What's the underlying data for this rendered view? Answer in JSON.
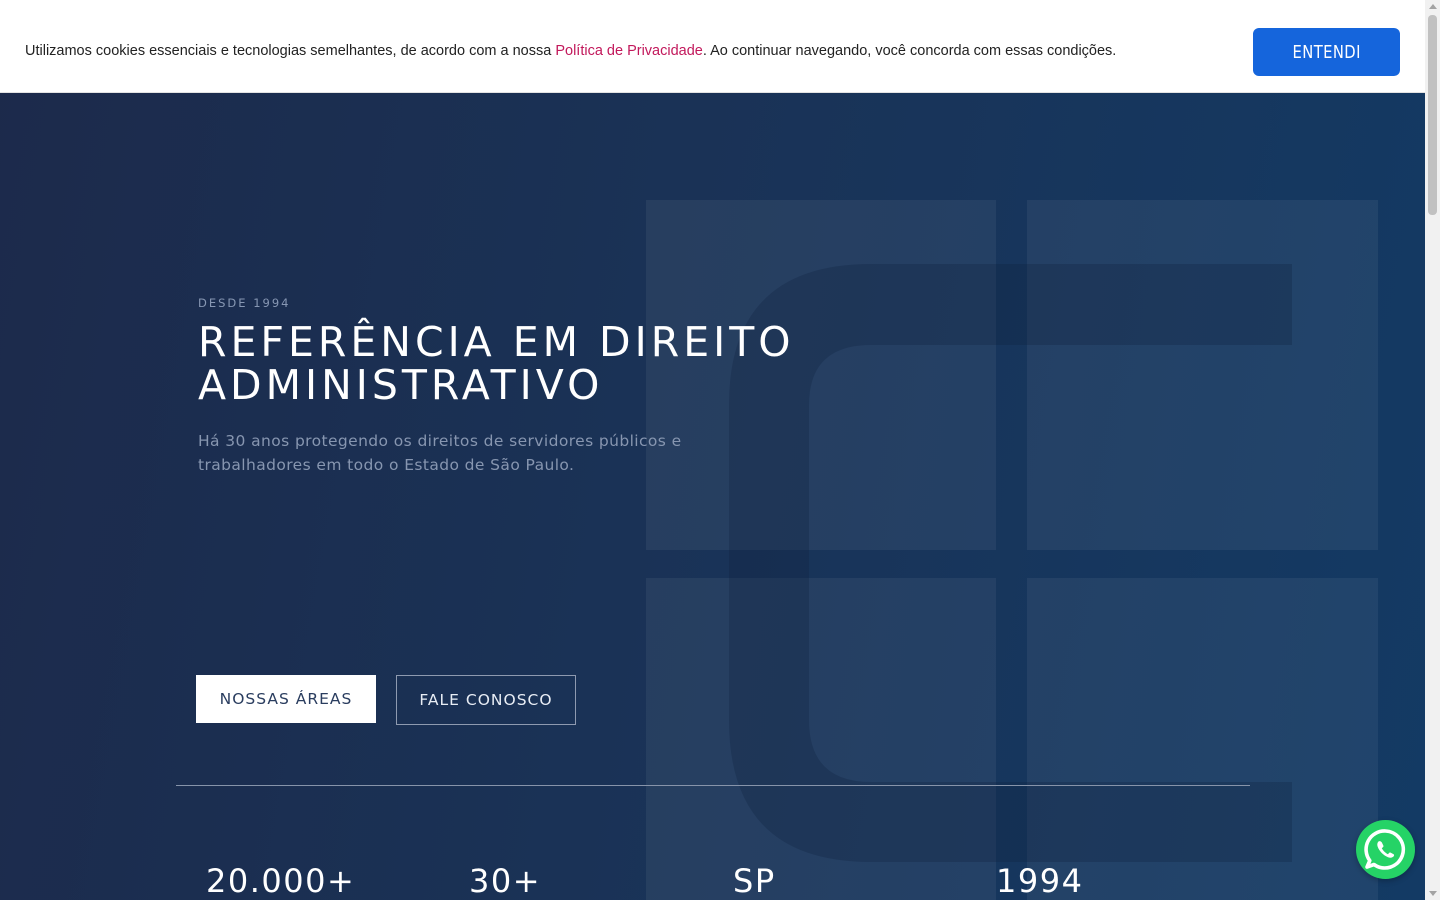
{
  "cookie_banner": {
    "text_before": "Utilizamos cookies essenciais e tecnologias semelhantes, de acordo com a nossa ",
    "link_label": "Política de Privacidade",
    "text_after": ". Ao continuar navegando, você concorda com essas condições.",
    "accept_label": "ENTENDI"
  },
  "hero": {
    "eyebrow": "DESDE 1994",
    "headline_line1": "REFERÊNCIA EM DIREITO",
    "headline_line2": "ADMINISTRATIVO",
    "subtitle_line1": "Há 30 anos protegendo os direitos de servidores públicos e",
    "subtitle_line2": "trabalhadores em todo o Estado de São Paulo.",
    "primary_button": "NOSSAS ÁREAS",
    "secondary_button": "FALE CONOSCO"
  },
  "stats": [
    "20.000+",
    "30+",
    "SP",
    "1994"
  ],
  "colors": {
    "cookie_accent": "#1565dc",
    "privacy_link": "#c2185b",
    "whatsapp": "#25d366",
    "hero_background": "#1a3256"
  },
  "icons": {
    "whatsapp": "whatsapp-icon",
    "brand_mark": "brand-logo-mark"
  }
}
